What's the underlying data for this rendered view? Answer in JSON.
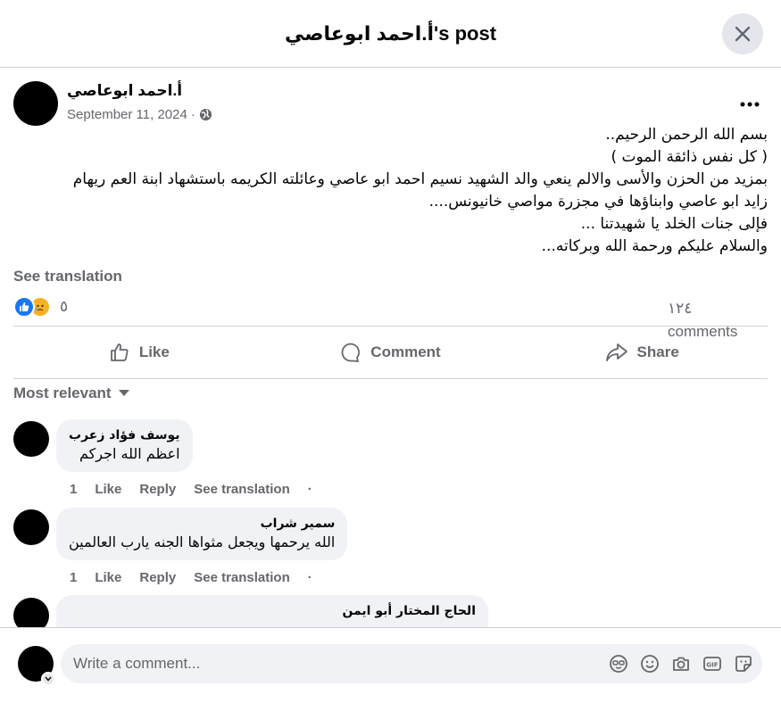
{
  "header": {
    "title": "أ.احمد ابوعاصي's post"
  },
  "post": {
    "author": "أ.احمد ابوعاصي",
    "date": "September 11, 2024",
    "separator": "·",
    "privacy_icon": "globe-icon",
    "body_lines": [
      "بسم الله الرحمن الرحيم..",
      "( كل نفس ذائقة الموت )",
      "بمزيد من الحزن والأسى والالم ينعي والد الشهيد نسيم احمد ابو عاصي وعائلته الكريمه باستشهاد ابنة العم ريهام",
      "زايد ابو عاصي وابناؤها في مجزرة مواصي خانيونس....",
      "فإلى جنات الخلد يا شهيدتنا ...",
      "والسلام عليكم ورحمة الله وبركاته..."
    ],
    "see_translation": "See translation",
    "reaction_count": "٥",
    "comments_count": "١٢٤ comments"
  },
  "actions": {
    "like": "Like",
    "comment": "Comment",
    "share": "Share"
  },
  "sort_label": "Most relevant",
  "comments": [
    {
      "name": "يوسف فؤاد زعرب",
      "text": "اعظم الله اجركم",
      "age": "1",
      "like": "Like",
      "reply": "Reply",
      "translate": "See translation",
      "dot": "·"
    },
    {
      "name": "سمير شراب",
      "text": "الله يرحمها ويجعل مثواها الجنه يارب العالمين",
      "age": "1",
      "like": "Like",
      "reply": "Reply",
      "translate": "See translation",
      "dot": "·"
    },
    {
      "name": "الحاج المختار أبو ايمن",
      "text": ""
    }
  ],
  "composer": {
    "placeholder": "Write a comment..."
  },
  "colors": {
    "accent": "#1877f2",
    "secondary_text": "#65676b",
    "bubble": "#f0f2f5"
  }
}
